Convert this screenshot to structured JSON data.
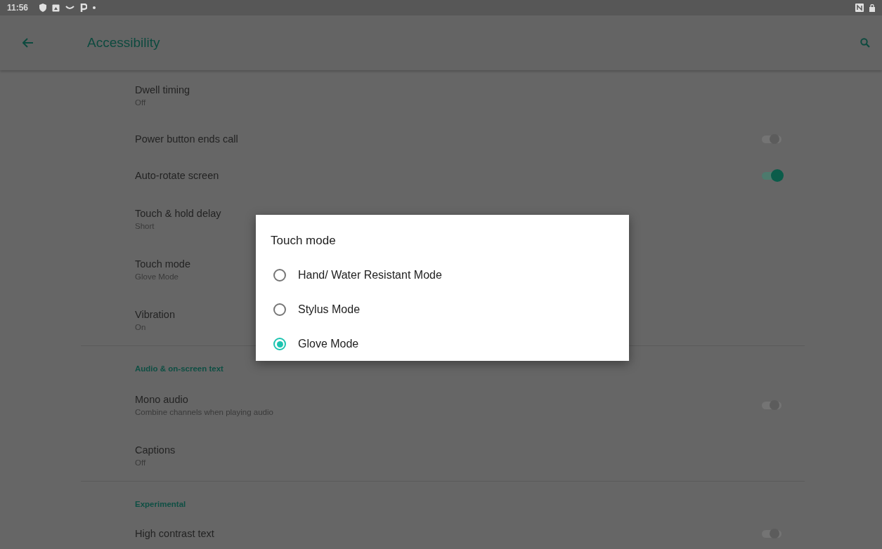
{
  "status_bar": {
    "time": "11:56"
  },
  "toolbar": {
    "title": "Accessibility"
  },
  "settings": [
    {
      "kind": "item",
      "title": "Dwell timing",
      "summary": "Off"
    },
    {
      "kind": "toggle",
      "title": "Power button ends call",
      "on": false
    },
    {
      "kind": "toggle",
      "title": "Auto-rotate screen",
      "on": true
    },
    {
      "kind": "item",
      "title": "Touch & hold delay",
      "summary": "Short"
    },
    {
      "kind": "item",
      "title": "Touch mode",
      "summary": "Glove Mode"
    },
    {
      "kind": "item",
      "title": "Vibration",
      "summary": "On"
    },
    {
      "kind": "header",
      "title": "Audio & on-screen text"
    },
    {
      "kind": "toggle",
      "title": "Mono audio",
      "summary": "Combine channels when playing audio",
      "on": false
    },
    {
      "kind": "item",
      "title": "Captions",
      "summary": "Off"
    },
    {
      "kind": "header",
      "title": "Experimental"
    },
    {
      "kind": "toggle",
      "title": "High contrast text",
      "on": false
    }
  ],
  "dialog": {
    "title": "Touch mode",
    "options": [
      {
        "label": "Hand/ Water Resistant Mode",
        "selected": false
      },
      {
        "label": "Stylus Mode",
        "selected": false
      },
      {
        "label": "Glove Mode",
        "selected": true
      }
    ]
  }
}
